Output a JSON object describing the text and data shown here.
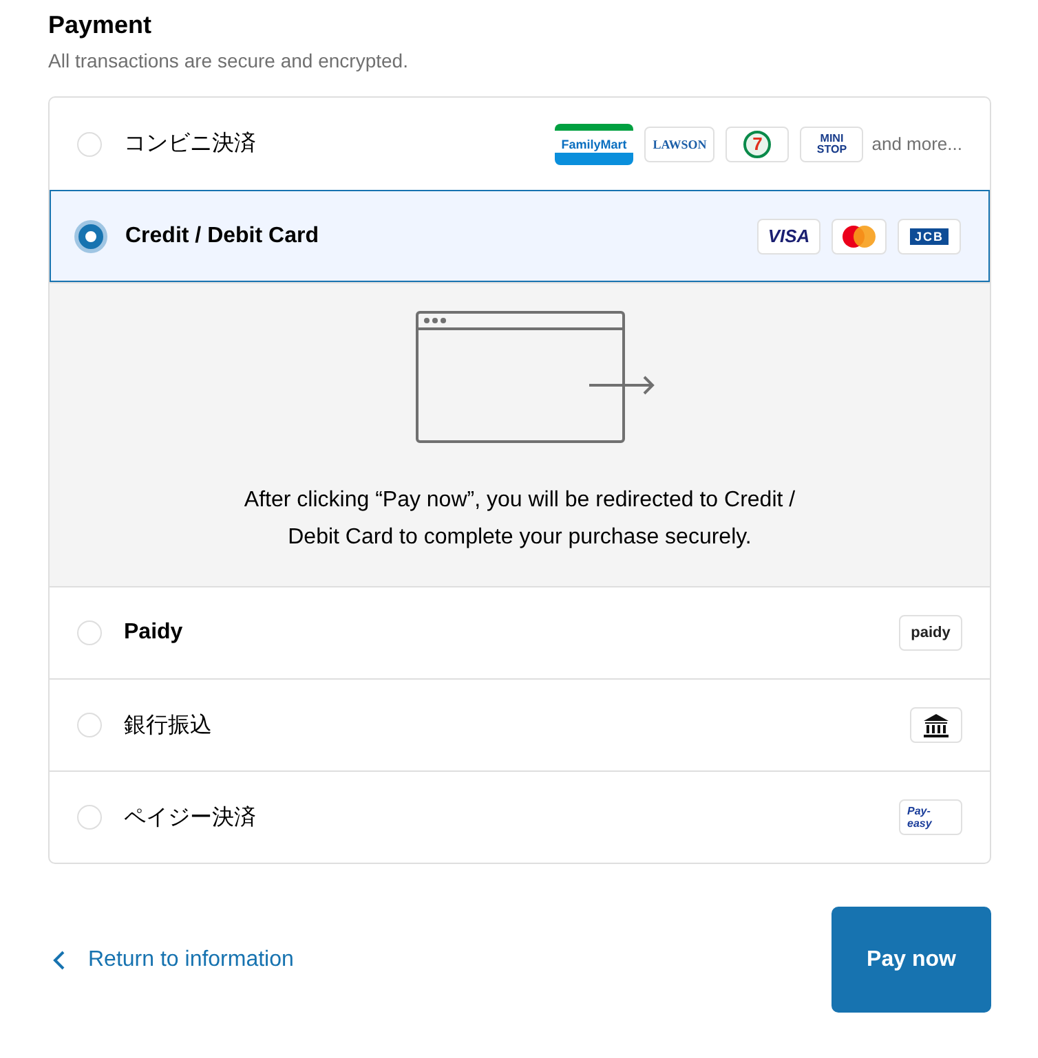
{
  "heading": "Payment",
  "subheading": "All transactions are secure and encrypted.",
  "methods": [
    {
      "label": "コンビニ決済",
      "bold": false,
      "selected": false,
      "logos": [
        {
          "kind": "familymart",
          "text": "FamilyMart"
        },
        {
          "kind": "lawson",
          "text": "LAWSON"
        },
        {
          "kind": "seven",
          "text": "7"
        },
        {
          "kind": "ministop",
          "text": "MINI STOP"
        }
      ],
      "more": "and more..."
    },
    {
      "label": "Credit / Debit Card",
      "bold": true,
      "selected": true,
      "logos": [
        {
          "kind": "visa",
          "text": "VISA"
        },
        {
          "kind": "mastercard"
        },
        {
          "kind": "jcb",
          "text": "JCB"
        }
      ],
      "redirect_text": "After clicking “Pay now”, you will be redirected to Credit / Debit Card to complete your purchase securely."
    },
    {
      "label": "Paidy",
      "bold": true,
      "selected": false,
      "logos": [
        {
          "kind": "paidy",
          "text": "paidy"
        }
      ]
    },
    {
      "label": "銀行振込",
      "bold": false,
      "selected": false,
      "logos": [
        {
          "kind": "bank"
        }
      ]
    },
    {
      "label": "ペイジー決済",
      "bold": false,
      "selected": false,
      "logos": [
        {
          "kind": "payeasy",
          "text": "Pay-easy"
        }
      ]
    }
  ],
  "return_link": "Return to information",
  "pay_button": "Pay now"
}
